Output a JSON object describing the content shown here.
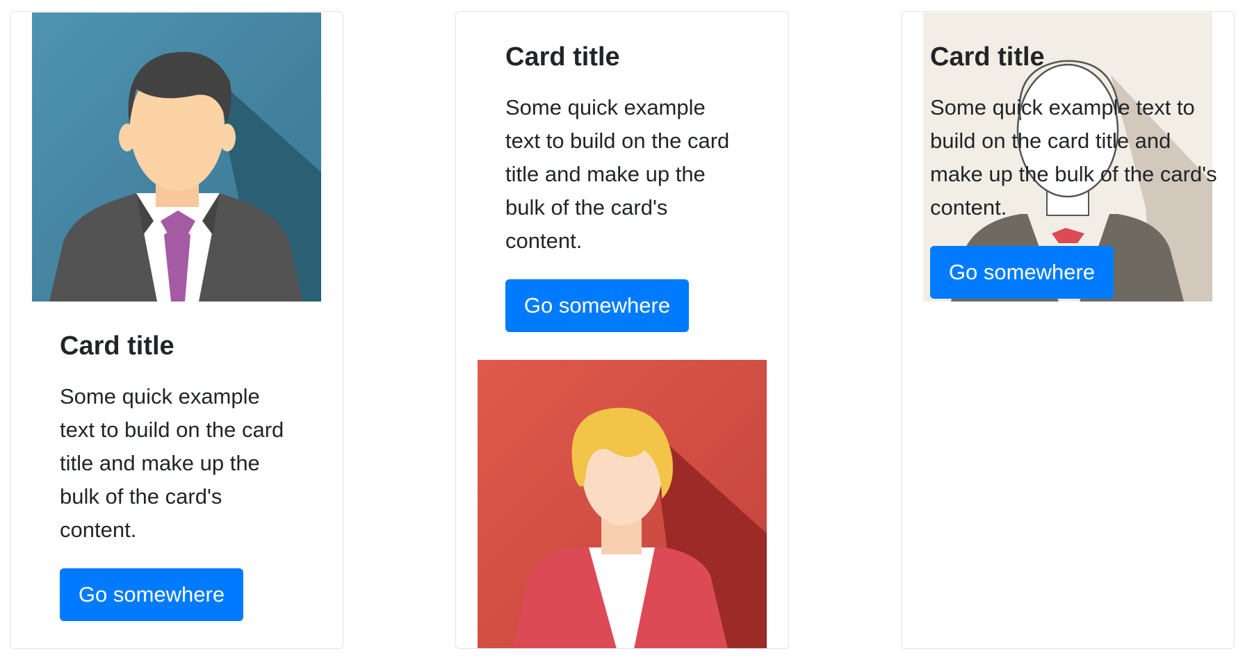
{
  "cards": [
    {
      "title": "Card title",
      "text": "Some quick example text to build on the card title and make up the bulk of the card's content.",
      "button": "Go somewhere",
      "image": "man-avatar",
      "image_bg": "#4a8eab"
    },
    {
      "title": "Card title",
      "text": "Some quick example text to build on the card title and make up the bulk of the card's content.",
      "button": "Go somewhere",
      "image": "woman-avatar",
      "image_bg": "#e05a4c"
    },
    {
      "title": "Card title",
      "text": "Some quick example text to build on the card title and make up the bulk of the card's content.",
      "button": "Go somewhere",
      "image": "outline-avatar",
      "image_bg": "#f2eee6"
    }
  ],
  "colors": {
    "primary": "#007bff",
    "border": "#dfe2e6",
    "text": "#212529"
  }
}
